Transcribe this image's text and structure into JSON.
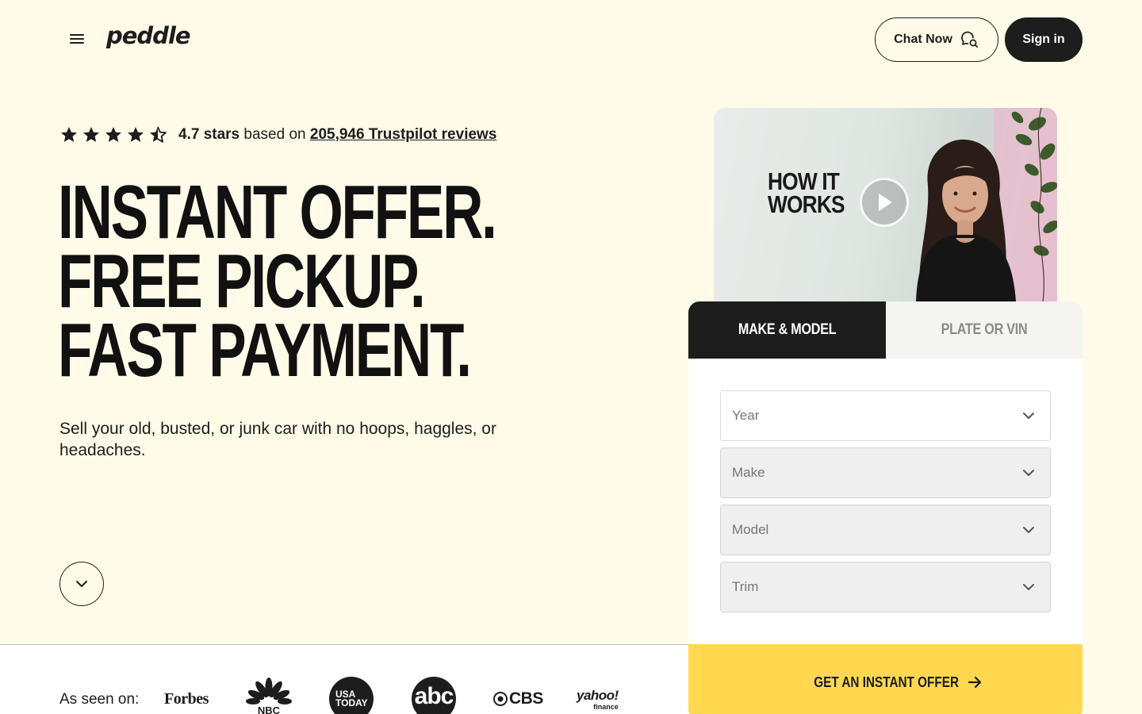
{
  "header": {
    "logo": "peddle",
    "chat_label": "Chat Now",
    "signin_label": "Sign in"
  },
  "rating": {
    "value": "4.7 stars",
    "stars": 4.5,
    "connector": "based on",
    "link": "205,946 Trustpilot reviews"
  },
  "hero": {
    "lines": [
      "INSTANT OFFER.",
      "FREE PICKUP.",
      "FAST PAYMENT."
    ],
    "subtext": "Sell your old, busted, or junk car with no hoops, haggles, or headaches."
  },
  "video": {
    "title_line1": "HOW IT",
    "title_line2": "WORKS"
  },
  "form": {
    "tabs": [
      {
        "label": "MAKE & MODEL",
        "active": true
      },
      {
        "label": "PLATE OR VIN",
        "active": false
      }
    ],
    "fields": [
      {
        "placeholder": "Year",
        "enabled": true
      },
      {
        "placeholder": "Make",
        "enabled": false
      },
      {
        "placeholder": "Model",
        "enabled": false
      },
      {
        "placeholder": "Trim",
        "enabled": false
      }
    ],
    "cta_label": "GET AN INSTANT OFFER"
  },
  "press": {
    "label": "As seen on:",
    "outlets": {
      "forbes": "Forbes",
      "nbc": "NBC",
      "usatoday_line1": "USA",
      "usatoday_line2": "TODAY",
      "abc": "abc",
      "cbs": "CBS",
      "yahoo": "yahoo!",
      "yahoo_sub": "finance"
    }
  },
  "colors": {
    "background": "#fffbe8",
    "dark": "#1d1d1d",
    "cta": "#ffd84f",
    "white": "#ffffff"
  }
}
